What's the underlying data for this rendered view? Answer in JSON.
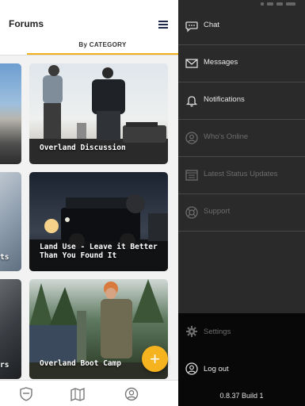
{
  "header": {
    "title": "Forums"
  },
  "tabs": {
    "active_label": "By CATEGORY"
  },
  "cards": [
    {
      "label": "Overland Discussion"
    },
    {
      "label": "Land Use - Leave it Better Than You Found It"
    },
    {
      "label": "Overland Boot Camp"
    }
  ],
  "left_cards": [
    {
      "label": ""
    },
    {
      "label": "ts"
    },
    {
      "label": "rs"
    }
  ],
  "fab": {
    "label": "+"
  },
  "bottom_nav": {
    "items": [
      "shield-icon",
      "map-icon",
      "profile-icon"
    ]
  },
  "drawer": {
    "items": [
      {
        "label": "Chat",
        "icon": "chat-icon",
        "enabled": true
      },
      {
        "label": "Messages",
        "icon": "envelope-icon",
        "enabled": true
      },
      {
        "label": "Notifications",
        "icon": "bell-icon",
        "enabled": true
      },
      {
        "label": "Who's Online",
        "icon": "user-circle-icon",
        "enabled": false
      },
      {
        "label": "Latest Status Updates",
        "icon": "list-icon",
        "enabled": false
      },
      {
        "label": "Support",
        "icon": "lifebuoy-icon",
        "enabled": false
      }
    ],
    "settings_label": "Settings",
    "logout_label": "Log out",
    "version": "0.8.37 Build 1"
  },
  "colors": {
    "accent": "#f5b31f",
    "drawer_bg": "#2a2a2a",
    "drawer_bottom": "#080808",
    "navy": "#1e2a4a"
  }
}
